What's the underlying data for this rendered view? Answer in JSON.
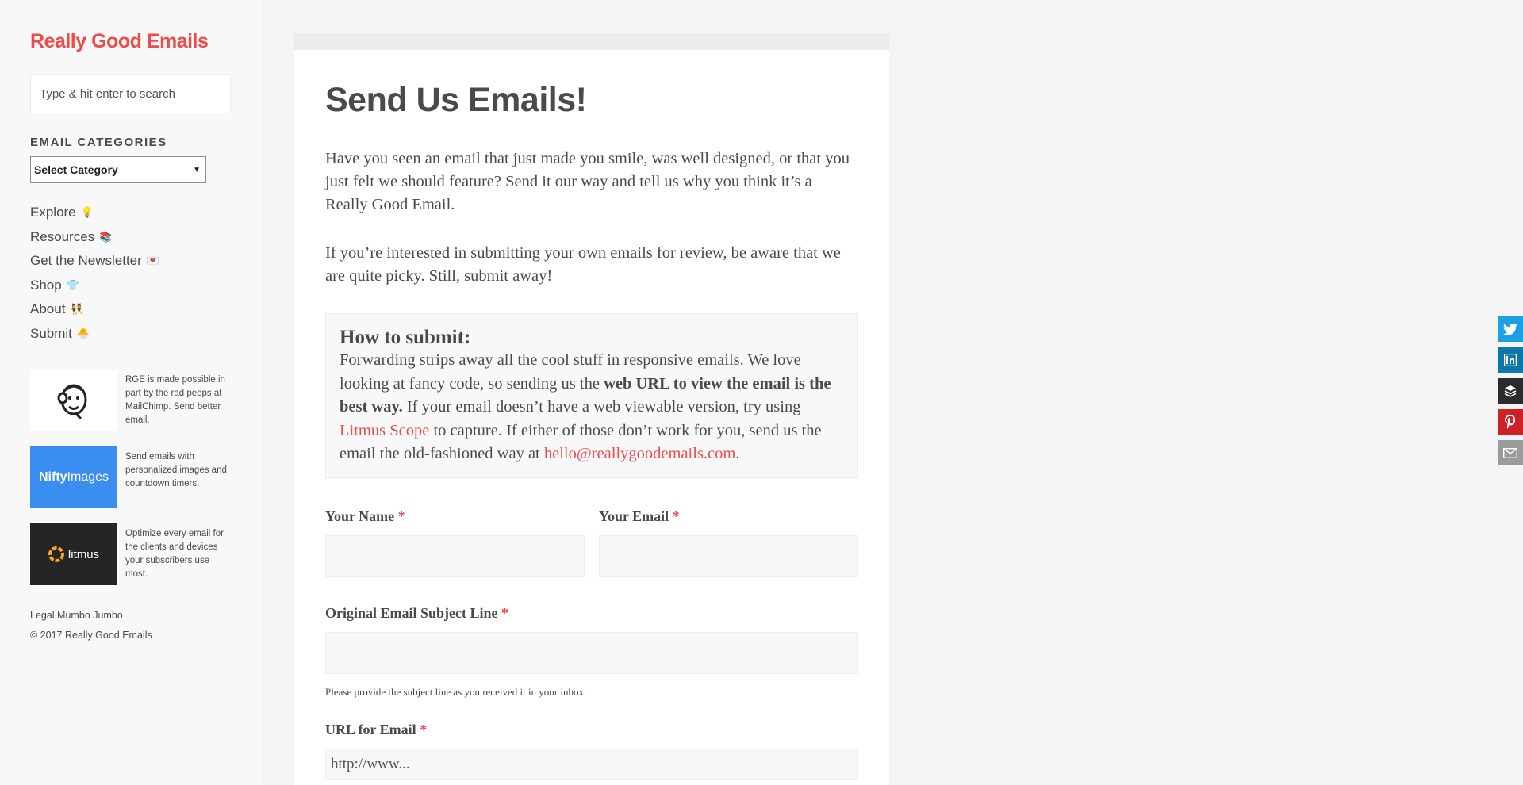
{
  "sidebar": {
    "site_title": "Really Good Emails",
    "search_placeholder": "Type & hit enter to search",
    "categories_heading": "EMAIL CATEGORIES",
    "category_select_value": "Select Category",
    "nav": [
      {
        "label": "Explore",
        "emoji": "💡"
      },
      {
        "label": "Resources",
        "emoji": "📚"
      },
      {
        "label": "Get the Newsletter",
        "emoji": "💌"
      },
      {
        "label": "Shop",
        "emoji": "👕"
      },
      {
        "label": "About",
        "emoji": "👯"
      },
      {
        "label": "Submit",
        "emoji": "🐣"
      }
    ],
    "sponsors": [
      {
        "name": "MailChimp",
        "text": "RGE is made possible in part by the rad peeps at MailChimp. Send better email."
      },
      {
        "name": "NiftyImages",
        "logo_a": "Nifty",
        "logo_b": "Images",
        "text": "Send emails with personalized images and countdown timers."
      },
      {
        "name": "litmus",
        "logo_text": "litmus",
        "text": "Optimize every email for the clients and devices your subscribers use most."
      }
    ],
    "legal": "Legal Mumbo Jumbo",
    "copyright": "© 2017 Really Good Emails"
  },
  "main": {
    "title": "Send Us Emails!",
    "intro_1": "Have you seen an email that just made you smile, was well designed, or that you just felt we should feature? Send it our way and tell us why you think it’s a Really Good Email.",
    "intro_2": "If you’re interested in submitting your own emails for review, be aware that we are quite picky. Still, submit away!",
    "how": {
      "heading": "How to submit:",
      "text_1": "Forwarding strips away all the cool stuff in responsive emails. We love looking at fancy code, so sending us the ",
      "bold": "web URL to view the email is the best way.",
      "text_2": " If your email doesn’t have a web viewable version, try using ",
      "link_1": "Litmus Scope",
      "text_3": " to capture. If either of those don’t work for you, send us the email the old-fashioned way at ",
      "link_2": "hello@reallygoodemails.com",
      "text_4": "."
    },
    "form": {
      "name_label": "Your Name",
      "email_label": "Your Email",
      "subject_label": "Original Email Subject Line",
      "subject_hint": "Please provide the subject line as you received it in your inbox.",
      "url_label": "URL for Email",
      "url_placeholder": "http://www...",
      "required_mark": "*"
    }
  },
  "share": {
    "items": [
      "twitter",
      "linkedin",
      "buffer",
      "pinterest",
      "email"
    ]
  },
  "colors": {
    "accent": "#ee4b4b",
    "text": "#4a4a4a",
    "nifty_blue": "#3a8ef0"
  }
}
